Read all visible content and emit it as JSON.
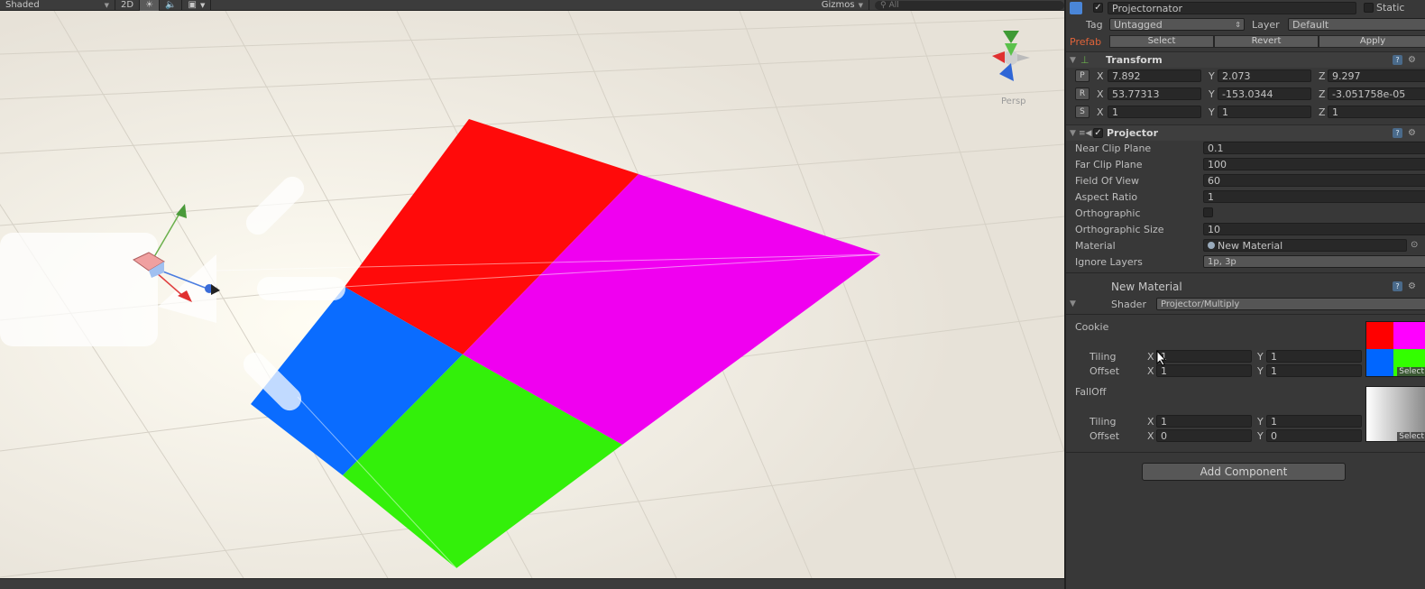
{
  "scene": {
    "toolbar": {
      "draw_mode": "Shaded",
      "mode_2d": "2D",
      "lighting_icon": "sun-icon",
      "audio_icon": "speaker-icon",
      "effects_icon": "image-icon",
      "gizmos_label": "Gizmos",
      "search_placeholder": "All"
    },
    "persp_label": "Persp",
    "quad_colors": {
      "top": "#ff0000",
      "right": "#ff00ff",
      "left": "#0066ff",
      "bottom": "#33ff00"
    }
  },
  "inspector": {
    "object_name": "Projectornator",
    "static_label": "Static",
    "tag_label": "Tag",
    "tag_value": "Untagged",
    "layer_label": "Layer",
    "layer_value": "Default",
    "prefab_label": "Prefab",
    "prefab_buttons": [
      "Select",
      "Revert",
      "Apply"
    ],
    "transform": {
      "title": "Transform",
      "position": {
        "label": "P",
        "x": "7.892",
        "y": "2.073",
        "z": "9.297"
      },
      "rotation": {
        "label": "R",
        "x": "53.77313",
        "y": "-153.0344",
        "z": "-3.051758e-05"
      },
      "scale": {
        "label": "S",
        "x": "1",
        "y": "1",
        "z": "1"
      }
    },
    "projector": {
      "title": "Projector",
      "properties": [
        {
          "label": "Near Clip Plane",
          "value": "0.1"
        },
        {
          "label": "Far Clip Plane",
          "value": "100"
        },
        {
          "label": "Field Of View",
          "value": "60"
        },
        {
          "label": "Aspect Ratio",
          "value": "1"
        },
        {
          "label": "Orthographic",
          "value": ""
        },
        {
          "label": "Orthographic Size",
          "value": "10"
        },
        {
          "label": "Material",
          "value": "New Material"
        },
        {
          "label": "Ignore Layers",
          "value": "1p, 3p"
        }
      ]
    },
    "material": {
      "title": "New Material",
      "shader_label": "Shader",
      "shader_value": "Projector/Multiply",
      "cookie": {
        "label": "Cookie",
        "tiling_label": "Tiling",
        "tiling_x": "1",
        "tiling_y": "1",
        "offset_label": "Offset",
        "offset_x": "1",
        "offset_y": "1",
        "select_label": "Select"
      },
      "falloff": {
        "label": "FallOff",
        "tiling_label": "Tiling",
        "tiling_x": "1",
        "tiling_y": "1",
        "offset_label": "Offset",
        "offset_x": "0",
        "offset_y": "0",
        "select_label": "Select"
      }
    },
    "add_component_label": "Add Component"
  },
  "axis_labels": {
    "x": "X",
    "y": "Y",
    "z": "Z"
  }
}
